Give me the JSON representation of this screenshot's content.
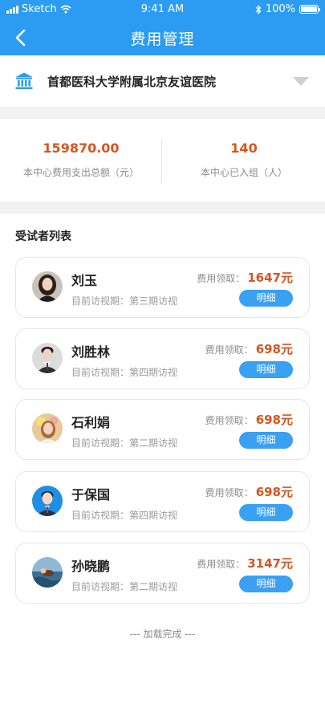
{
  "status_bar": {
    "carrier": "Sketch",
    "time": "9:41 AM",
    "battery": "100%"
  },
  "nav": {
    "title": "费用管理"
  },
  "hospital": {
    "name": "首都医科大学附属北京友谊医院",
    "icon": "bank-icon"
  },
  "stats": [
    {
      "value": "159870.00",
      "label": "本中心费用支出总额（元）"
    },
    {
      "value": "140",
      "label": "本中心已入组（人）"
    }
  ],
  "list": {
    "title": "受试者列表",
    "fee_label": "费用领取：",
    "detail_label": "明细",
    "items": [
      {
        "name": "刘玉",
        "visit": "目前访视期：第三期访视",
        "fee": "1647元"
      },
      {
        "name": "刘胜林",
        "visit": "目前访视期：第四期访视",
        "fee": "698元"
      },
      {
        "name": "石利娟",
        "visit": "目前访视期：第二期访视",
        "fee": "698元"
      },
      {
        "name": "于保国",
        "visit": "目前访视期：第四期访视",
        "fee": "698元"
      },
      {
        "name": "孙晓鹏",
        "visit": "目前访视期：第二期访视",
        "fee": "3147元"
      }
    ]
  },
  "footer": {
    "note": "--- 加载完成 ---"
  },
  "colors": {
    "primary": "#2b9cf2",
    "accent": "#d9541e",
    "button": "#3aa0f2"
  }
}
